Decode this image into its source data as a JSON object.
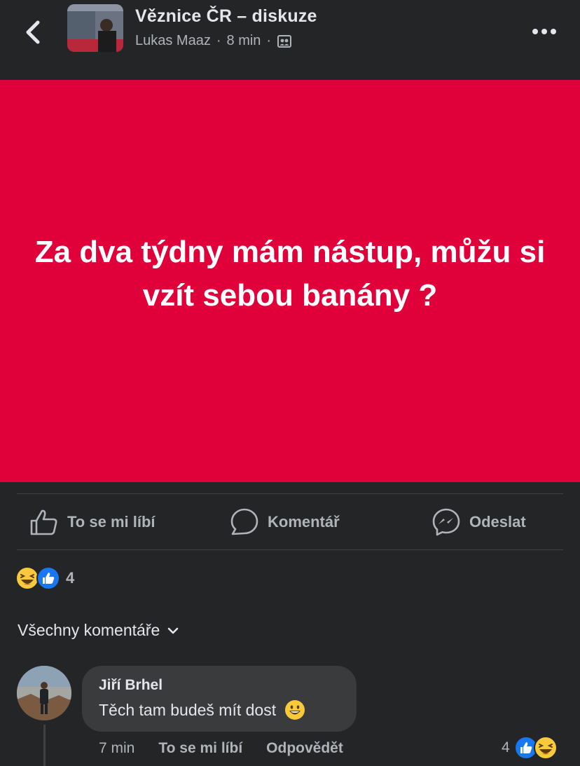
{
  "header": {
    "group_name": "Věznice ČR – diskuze",
    "author": "Lukas Maaz",
    "separator": "·",
    "time": "8 min"
  },
  "post": {
    "text": "Za dva týdny mám nástup, můžu si vzít sebou banány ?",
    "background": "#e0003a"
  },
  "actions": {
    "like": "To se mi líbí",
    "comment": "Komentář",
    "share": "Odeslat"
  },
  "reactions": {
    "count": "4"
  },
  "comments_filter": "Všechny komentáře",
  "comment": {
    "author": "Jiří Brhel",
    "text": "Těch tam budeš mít dost",
    "time": "7 min",
    "like": "To se mi líbí",
    "reply": "Odpovědět",
    "reaction_count": "4"
  },
  "colors": {
    "accent_blue": "#1877f2",
    "emoji_yellow": "#f7c93b",
    "text_secondary": "#b0b3b8"
  }
}
